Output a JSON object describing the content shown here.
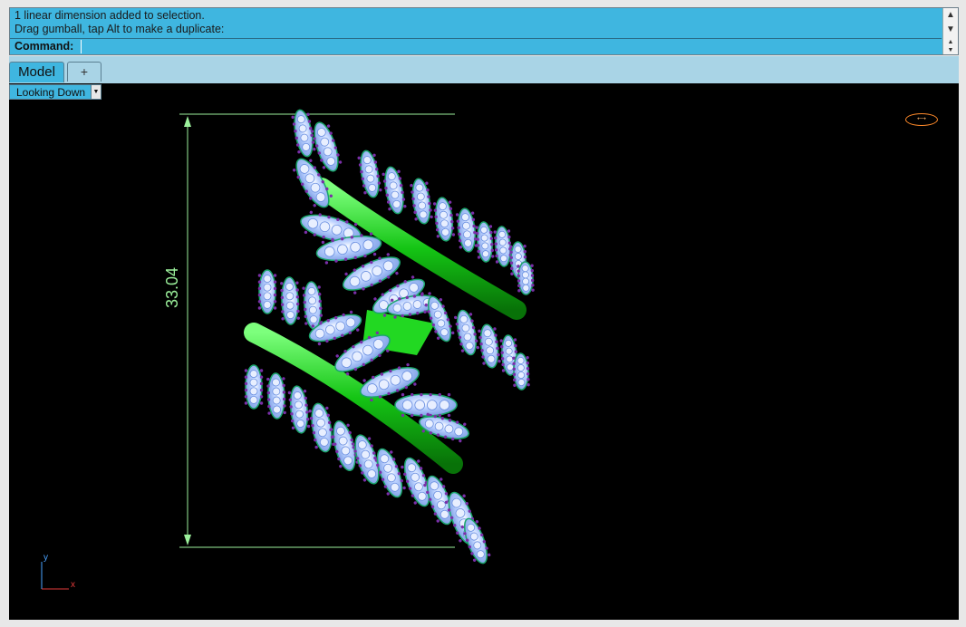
{
  "command_history": {
    "lines": [
      "1 linear dimension added to selection.",
      "Drag gumball, tap Alt to make a duplicate:"
    ],
    "scroll_up_glyph": "^",
    "scroll_down_glyph": "v"
  },
  "command_prompt": {
    "label": "Command:",
    "value": ""
  },
  "tabs": {
    "model_label": "Model",
    "add_glyph": "+"
  },
  "viewport": {
    "view_label": "Looking Down",
    "dimension_value": "33.04",
    "axis_y_label": "y",
    "axis_x_label": "x",
    "colors": {
      "background": "#000000",
      "ring_green": "#18d818",
      "gem_blue": "#8fb4ff",
      "prong_purple": "#7a2fa8",
      "dimension_line": "#9bf09b",
      "gumball": "#ff8a2a"
    }
  }
}
